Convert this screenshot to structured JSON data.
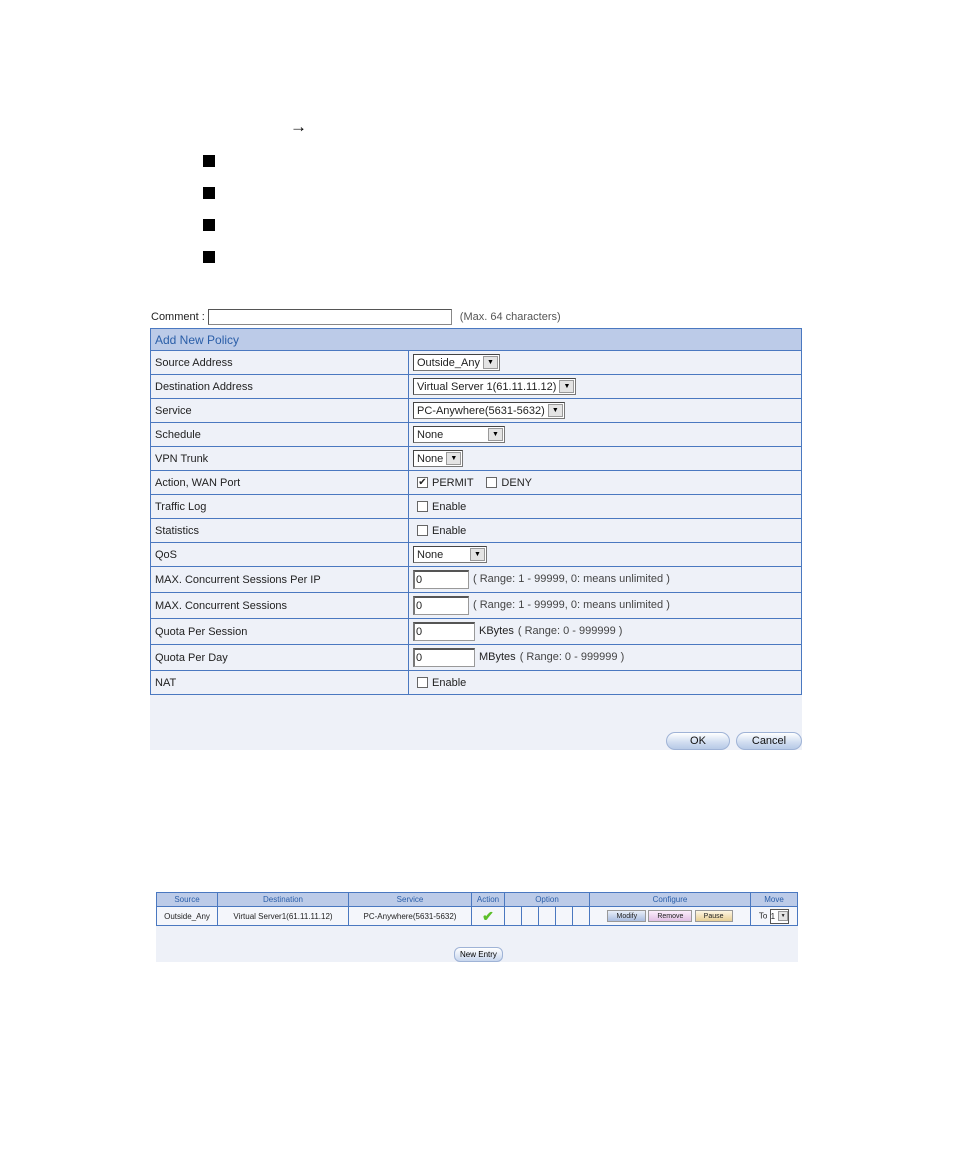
{
  "decorations": {
    "arrow": "→",
    "bullet_count": 4
  },
  "form": {
    "comment_label": "Comment :",
    "comment_value": "",
    "comment_hint": "(Max. 64 characters)",
    "header": "Add New Policy",
    "rows": {
      "source_address": {
        "label": "Source Address",
        "value": "Outside_Any"
      },
      "destination_address": {
        "label": "Destination Address",
        "value": "Virtual Server 1(61.11.11.12)"
      },
      "service": {
        "label": "Service",
        "value": "PC-Anywhere(5631-5632)"
      },
      "schedule": {
        "label": "Schedule",
        "value": "None"
      },
      "vpn_trunk": {
        "label": "VPN Trunk",
        "value": "None"
      },
      "action_wan_port": {
        "label": "Action, WAN Port",
        "permit_label": "PERMIT",
        "permit_checked": true,
        "deny_label": "DENY",
        "deny_checked": false
      },
      "traffic_log": {
        "label": "Traffic Log",
        "option_label": "Enable",
        "checked": false
      },
      "statistics": {
        "label": "Statistics",
        "option_label": "Enable",
        "checked": false
      },
      "qos": {
        "label": "QoS",
        "value": "None"
      },
      "max_sessions_per_ip": {
        "label": "MAX. Concurrent Sessions Per IP",
        "value": "0",
        "hint": "( Range: 1 - 99999, 0: means unlimited )"
      },
      "max_sessions": {
        "label": "MAX. Concurrent Sessions",
        "value": "0",
        "hint": "( Range: 1 - 99999, 0: means unlimited )"
      },
      "quota_per_session": {
        "label": "Quota Per Session",
        "value": "0",
        "unit": "KBytes",
        "hint": "( Range: 0 - 999999 )"
      },
      "quota_per_day": {
        "label": "Quota Per Day",
        "value": "0",
        "unit": "MBytes",
        "hint": "( Range: 0 - 999999 )"
      },
      "nat": {
        "label": "NAT",
        "option_label": "Enable",
        "checked": false
      }
    },
    "ok_label": "OK",
    "cancel_label": "Cancel"
  },
  "policy_list": {
    "headers": [
      "Source",
      "Destination",
      "Service",
      "Action",
      "Option",
      "Configure",
      "Move"
    ],
    "rows": [
      {
        "source": "Outside_Any",
        "destination": "Virtual Server1(61.11.11.12)",
        "service": "PC-Anywhere(5631-5632)",
        "action_icon": "✔",
        "modify_label": "Modify",
        "remove_label": "Remove",
        "pause_label": "Pause",
        "move_prefix": "To",
        "move_value": "1"
      }
    ],
    "new_entry_label": "New Entry"
  },
  "colors": {
    "header_bg": "#bccbe8",
    "header_text": "#2a5ea8",
    "border": "#4a78c0",
    "row_bg": "#eef1f8",
    "permit_check": "#5cbf2a"
  }
}
